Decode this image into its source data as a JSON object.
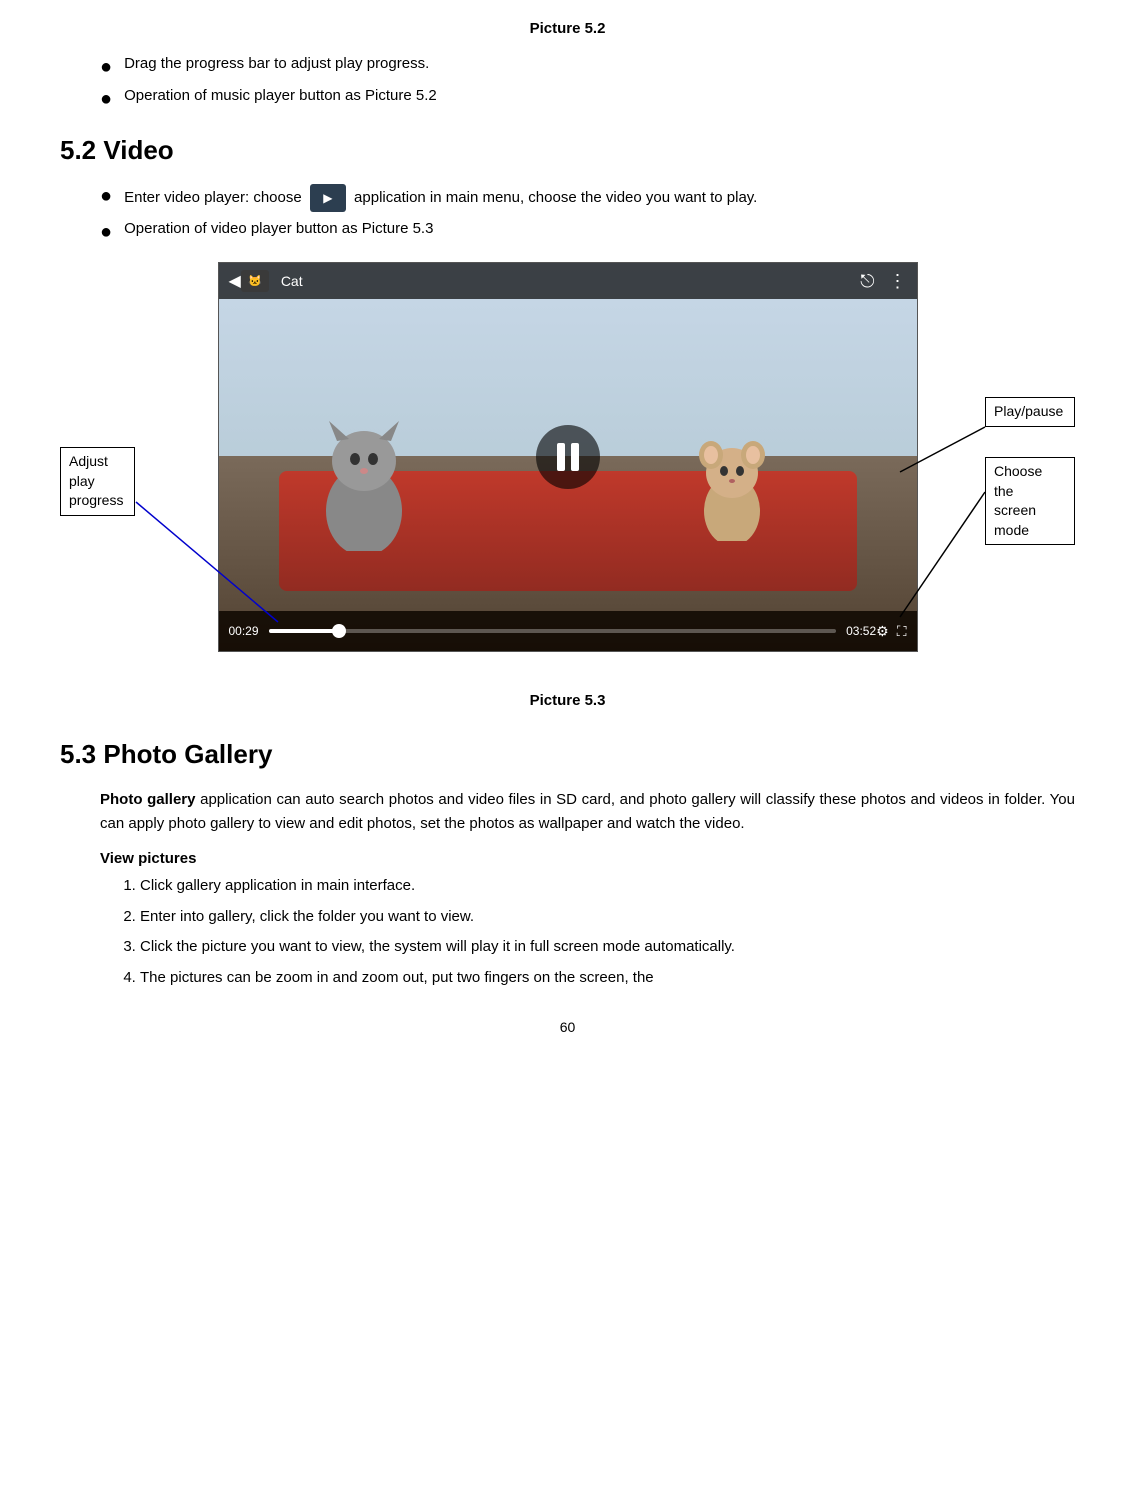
{
  "page": {
    "title": "Picture 5.2",
    "bullets_52": [
      "Drag the progress bar to adjust play progress.",
      "Operation of music player button as Picture 5.2"
    ],
    "section_52": {
      "heading": "5.2 Video",
      "bullets": [
        "Enter video player: choose  application in main menu, choose the video you want to play.",
        "Operation of video player button as Picture 5.3"
      ]
    },
    "video_player": {
      "title": "Cat",
      "time_current": "00:29",
      "time_total": "03:52"
    },
    "labels": {
      "adjust_play_progress": "Adjust\nplay\nprogress",
      "play_pause": "Play/pause",
      "choose_screen_mode": "Choose\nthe\nscreen\nmode"
    },
    "figure_53": "Picture 5.3",
    "section_53": {
      "heading": "5.3 Photo Gallery",
      "intro_bold": "Photo gallery",
      "intro_rest": " application can auto search photos and video files in SD card, and photo gallery will classify these photos and videos in folder. You can apply photo gallery to view and edit photos, set the photos as wallpaper and watch the video.",
      "sub_heading": "View pictures",
      "steps": [
        "Click gallery application in main interface.",
        "Enter into gallery, click the folder you want to view.",
        "Click the picture you want to view, the system will play it in full screen mode automatically.",
        "The pictures can be zoom in and zoom out, put two fingers on the screen, the"
      ]
    },
    "page_number": "60"
  }
}
